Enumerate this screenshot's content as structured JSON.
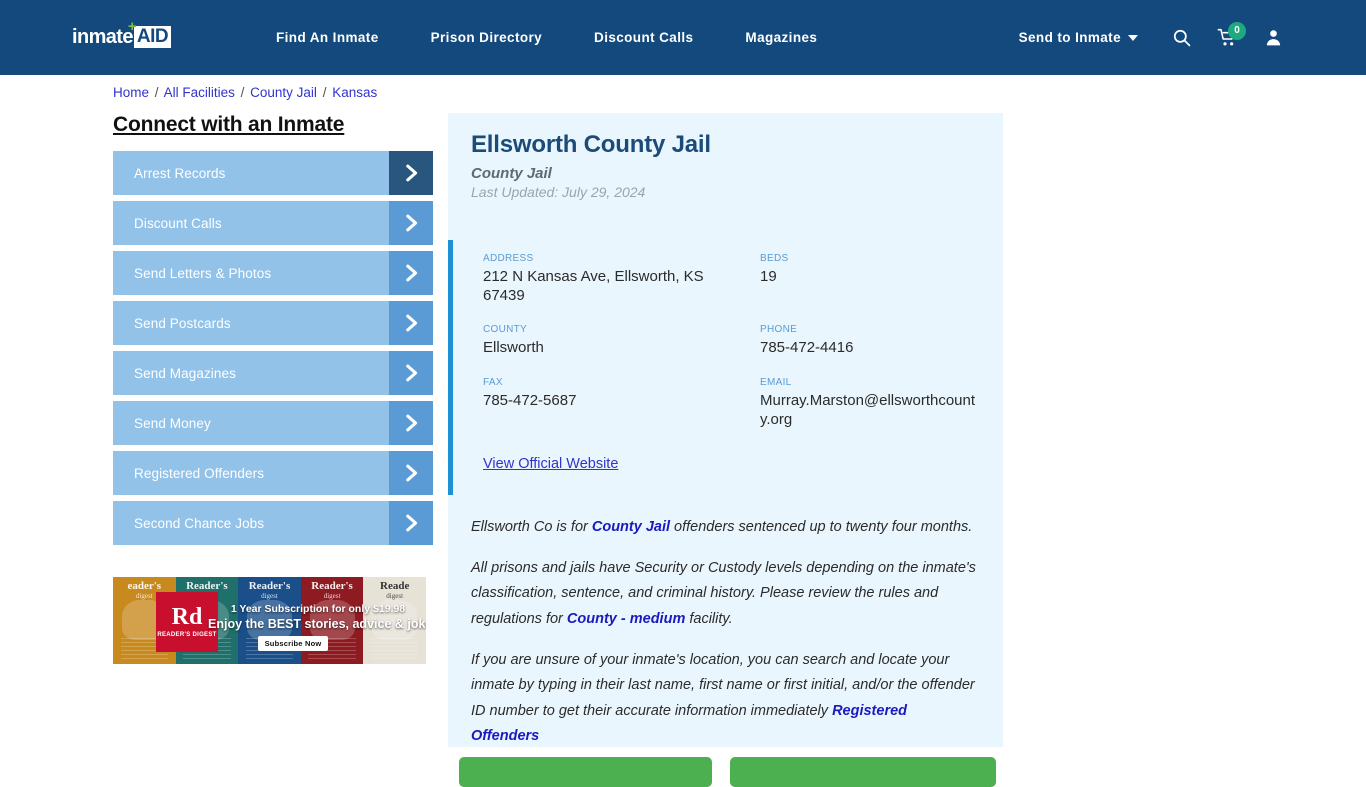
{
  "header": {
    "logo": {
      "word": "inmate",
      "badge": "AID",
      "plus": "+"
    },
    "nav": [
      {
        "label": "Find An Inmate"
      },
      {
        "label": "Prison Directory"
      },
      {
        "label": "Discount Calls"
      },
      {
        "label": "Magazines"
      }
    ],
    "send_to_inmate": "Send to Inmate",
    "icons": {
      "search": "search-icon",
      "cart": "cart-icon",
      "account": "user-icon"
    },
    "cart_count": "0",
    "colors": {
      "bar": "#13497c",
      "badge": "#1fa97e"
    }
  },
  "breadcrumb": {
    "items": [
      "Home",
      "All Facilities",
      "County Jail",
      "Kansas"
    ],
    "separator": "/"
  },
  "sidebar": {
    "title": "Connect with an Inmate",
    "items": [
      {
        "label": "Arrest Records",
        "active": true
      },
      {
        "label": "Discount Calls",
        "active": false
      },
      {
        "label": "Send Letters & Photos",
        "active": false
      },
      {
        "label": "Send Postcards",
        "active": false
      },
      {
        "label": "Send Magazines",
        "active": false
      },
      {
        "label": "Send Money",
        "active": false
      },
      {
        "label": "Registered Offenders",
        "active": false
      },
      {
        "label": "Second Chance Jobs",
        "active": false
      }
    ],
    "ad": {
      "brand_big": "Rd",
      "brand_small": "READER'S DIGEST",
      "line1": "1 Year Subscription for only $19.98",
      "line2": "Enjoy the BEST stories, advice & jokes!",
      "button": "Subscribe Now",
      "covers": [
        {
          "title": "eader's",
          "sub": "digest",
          "color": "#c88a1e"
        },
        {
          "title": "Reader's",
          "sub": "digest",
          "color": "#1f6f6a"
        },
        {
          "title": "Reader's",
          "sub": "digest",
          "color": "#1b4f8a"
        },
        {
          "title": "Reader's",
          "sub": "digest",
          "color": "#8e1b22"
        },
        {
          "title": "Reade",
          "sub": "digest",
          "color": "#e7e2d6"
        }
      ]
    }
  },
  "facility": {
    "name": "Ellsworth County Jail",
    "type": "County Jail",
    "last_updated": "Last Updated: July 29, 2024",
    "details": [
      {
        "label": "ADDRESS",
        "value": "212 N Kansas Ave, Ellsworth, KS 67439"
      },
      {
        "label": "BEDS",
        "value": "19"
      },
      {
        "label": "COUNTY",
        "value": "Ellsworth"
      },
      {
        "label": "PHONE",
        "value": "785-472-4416"
      },
      {
        "label": "FAX",
        "value": "785-472-5687"
      },
      {
        "label": "EMAIL",
        "value": "Murray.Marston@ellsworthcounty.org"
      }
    ],
    "website_link": "View Official Website",
    "paragraphs": [
      {
        "segments": [
          {
            "t": "Ellsworth Co is for ",
            "link": false
          },
          {
            "t": "County Jail",
            "link": true
          },
          {
            "t": " offenders sentenced up to twenty four months.",
            "link": false
          }
        ]
      },
      {
        "segments": [
          {
            "t": "All prisons and jails have Security or Custody levels depending on the inmate's classification, sentence, and criminal history. Please review the rules and regulations for ",
            "link": false
          },
          {
            "t": "County - medium",
            "link": true
          },
          {
            "t": " facility.",
            "link": false
          }
        ]
      },
      {
        "segments": [
          {
            "t": "If you are unsure of your inmate's location, you can search and locate your inmate by typing in their last name, first name or first initial, and/or the offender ID number to get their accurate information immediately ",
            "link": false
          },
          {
            "t": "Registered Offenders",
            "link": true
          }
        ]
      }
    ],
    "cta": [
      {
        "label": ""
      },
      {
        "label": ""
      }
    ]
  }
}
